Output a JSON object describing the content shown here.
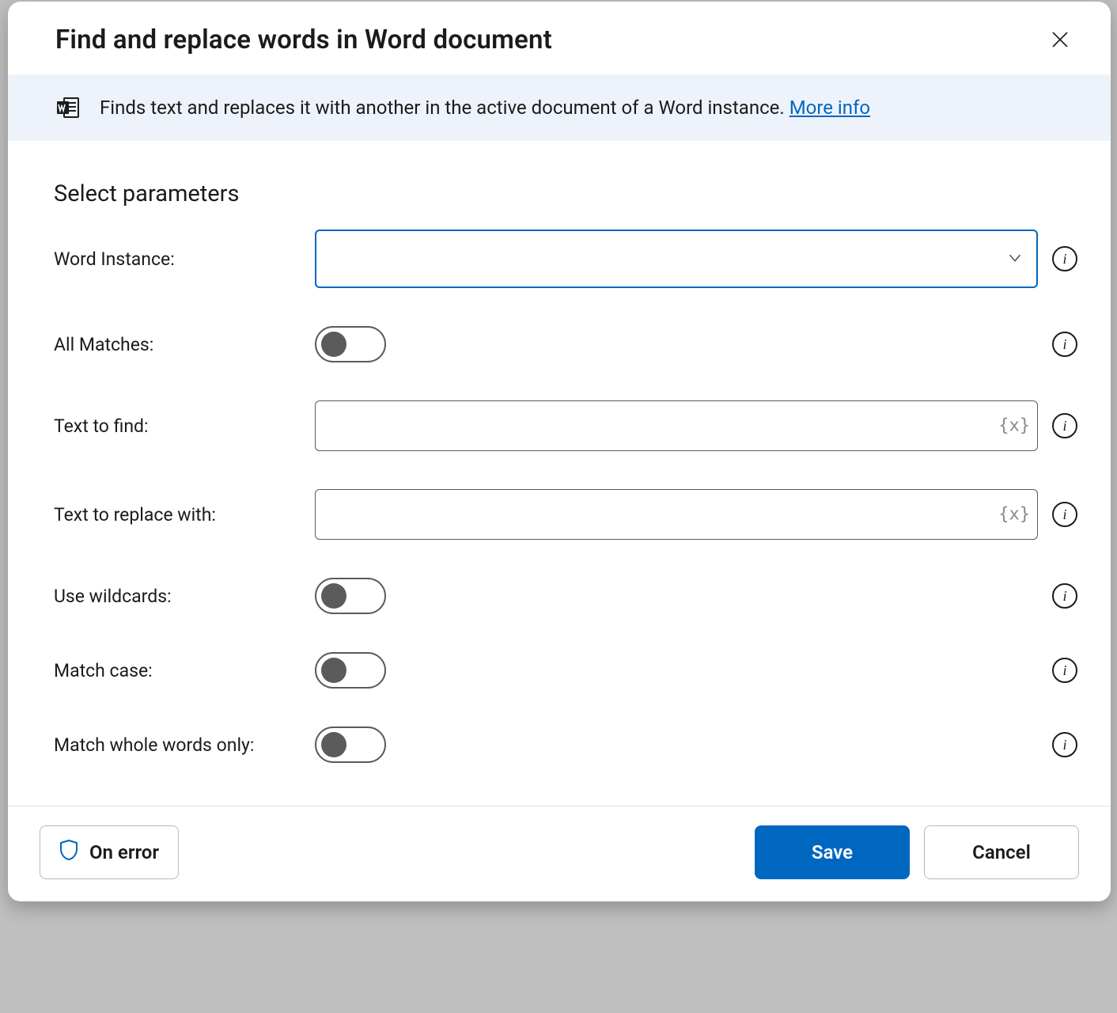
{
  "dialog": {
    "title": "Find and replace words in Word document",
    "banner_text": "Finds text and replaces it with another in the active document of a Word instance. ",
    "more_info": "More info",
    "section_title": "Select parameters"
  },
  "params": {
    "word_instance": {
      "label": "Word Instance:",
      "value": ""
    },
    "all_matches": {
      "label": "All Matches:",
      "value": false
    },
    "text_to_find": {
      "label": "Text to find:",
      "value": ""
    },
    "text_to_replace": {
      "label": "Text to replace with:",
      "value": ""
    },
    "use_wildcards": {
      "label": "Use wildcards:",
      "value": false
    },
    "match_case": {
      "label": "Match case:",
      "value": false
    },
    "match_whole_words": {
      "label": "Match whole words only:",
      "value": false
    }
  },
  "footer": {
    "on_error": "On error",
    "save": "Save",
    "cancel": "Cancel"
  },
  "icons": {
    "variable": "{x}",
    "info": "i"
  }
}
